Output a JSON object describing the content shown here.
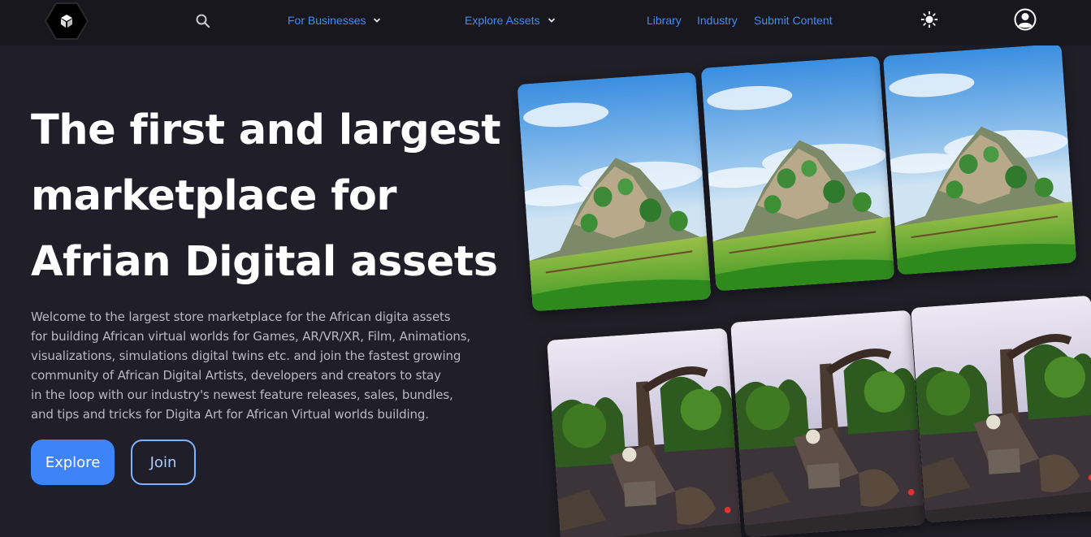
{
  "nav": {
    "logo_icon": "cube-icon",
    "search_icon": "search-icon",
    "for_businesses": "For Businesses",
    "explore_assets": "Explore Assets",
    "library": "Library",
    "industry": "Industry",
    "submit_content": "Submit Content",
    "theme_icon": "sun-icon",
    "user_icon": "user-circle-icon",
    "link_color": "#3f8cf5"
  },
  "hero": {
    "title_lines": [
      "The first and largest",
      "marketplace for",
      "Afrian Digital assets"
    ],
    "description": "Welcome to the largest store marketplace for the African digita assets\nfor building African virtual worlds for Games, AR/VR/XR, Film, Animations,\nvisualizations, simulations digital twins etc. and join the fastest growing\ncommunity of African Digital Artists, developers and creators to stay\nin the loop with our industry's newest feature releases, sales, bundles,\nand tips and tricks for Digita Art for African Virtual worlds building.",
    "explore_label": "Explore",
    "join_label": "Join",
    "accent": "#3e83f7"
  },
  "gallery": {
    "row1_scene": "sky-island-landscape",
    "row2_scene": "dark-forest-ruins"
  }
}
